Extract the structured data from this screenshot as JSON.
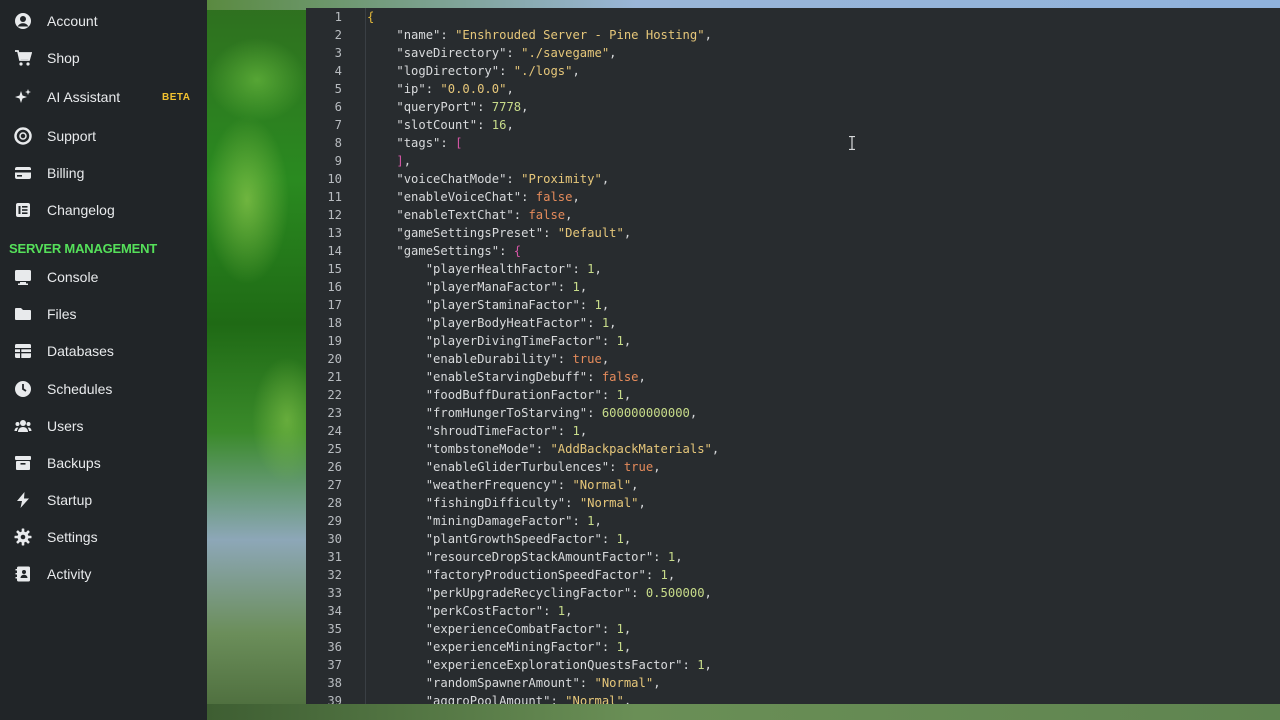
{
  "sidebar": {
    "items": [
      {
        "label": "Account",
        "icon": "account-icon"
      },
      {
        "label": "Shop",
        "icon": "cart-icon"
      },
      {
        "label": "AI Assistant",
        "icon": "sparkle-icon",
        "badge": "BETA"
      },
      {
        "label": "Support",
        "icon": "support-icon"
      },
      {
        "label": "Billing",
        "icon": "billing-icon"
      },
      {
        "label": "Changelog",
        "icon": "changelog-icon"
      }
    ],
    "section_header": "SERVER MANAGEMENT",
    "server_items": [
      {
        "label": "Console",
        "icon": "console-icon"
      },
      {
        "label": "Files",
        "icon": "folder-icon"
      },
      {
        "label": "Databases",
        "icon": "database-icon"
      },
      {
        "label": "Schedules",
        "icon": "clock-icon"
      },
      {
        "label": "Users",
        "icon": "users-icon"
      },
      {
        "label": "Backups",
        "icon": "backup-icon"
      },
      {
        "label": "Startup",
        "icon": "bolt-icon"
      },
      {
        "label": "Settings",
        "icon": "gear-icon"
      },
      {
        "label": "Activity",
        "icon": "activity-icon"
      }
    ]
  },
  "editor": {
    "lines": [
      {
        "n": "1",
        "indent": 0,
        "tokens": [
          [
            "br1",
            "{"
          ]
        ]
      },
      {
        "n": "2",
        "indent": 1,
        "tokens": [
          [
            "k",
            "\"name\""
          ],
          [
            "p",
            ": "
          ],
          [
            "s",
            "\"Enshrouded Server - Pine Hosting\""
          ],
          [
            "p",
            ","
          ]
        ]
      },
      {
        "n": "3",
        "indent": 1,
        "tokens": [
          [
            "k",
            "\"saveDirectory\""
          ],
          [
            "p",
            ": "
          ],
          [
            "s",
            "\"./savegame\""
          ],
          [
            "p",
            ","
          ]
        ]
      },
      {
        "n": "4",
        "indent": 1,
        "tokens": [
          [
            "k",
            "\"logDirectory\""
          ],
          [
            "p",
            ": "
          ],
          [
            "s",
            "\"./logs\""
          ],
          [
            "p",
            ","
          ]
        ]
      },
      {
        "n": "5",
        "indent": 1,
        "tokens": [
          [
            "k",
            "\"ip\""
          ],
          [
            "p",
            ": "
          ],
          [
            "s",
            "\"0.0.0.0\""
          ],
          [
            "p",
            ","
          ]
        ]
      },
      {
        "n": "6",
        "indent": 1,
        "tokens": [
          [
            "k",
            "\"queryPort\""
          ],
          [
            "p",
            ": "
          ],
          [
            "n",
            "7778"
          ],
          [
            "p",
            ","
          ]
        ]
      },
      {
        "n": "7",
        "indent": 1,
        "tokens": [
          [
            "k",
            "\"slotCount\""
          ],
          [
            "p",
            ": "
          ],
          [
            "n",
            "16"
          ],
          [
            "p",
            ","
          ]
        ]
      },
      {
        "n": "8",
        "indent": 1,
        "tokens": [
          [
            "k",
            "\"tags\""
          ],
          [
            "p",
            ": "
          ],
          [
            "br2",
            "["
          ]
        ]
      },
      {
        "n": "9",
        "indent": 1,
        "tokens": [
          [
            "br2",
            "]"
          ],
          [
            "p",
            ","
          ]
        ]
      },
      {
        "n": "10",
        "indent": 1,
        "tokens": [
          [
            "k",
            "\"voiceChatMode\""
          ],
          [
            "p",
            ": "
          ],
          [
            "s",
            "\"Proximity\""
          ],
          [
            "p",
            ","
          ]
        ]
      },
      {
        "n": "11",
        "indent": 1,
        "tokens": [
          [
            "k",
            "\"enableVoiceChat\""
          ],
          [
            "p",
            ": "
          ],
          [
            "b",
            "false"
          ],
          [
            "p",
            ","
          ]
        ]
      },
      {
        "n": "12",
        "indent": 1,
        "tokens": [
          [
            "k",
            "\"enableTextChat\""
          ],
          [
            "p",
            ": "
          ],
          [
            "b",
            "false"
          ],
          [
            "p",
            ","
          ]
        ]
      },
      {
        "n": "13",
        "indent": 1,
        "tokens": [
          [
            "k",
            "\"gameSettingsPreset\""
          ],
          [
            "p",
            ": "
          ],
          [
            "s",
            "\"Default\""
          ],
          [
            "p",
            ","
          ]
        ]
      },
      {
        "n": "14",
        "indent": 1,
        "tokens": [
          [
            "k",
            "\"gameSettings\""
          ],
          [
            "p",
            ": "
          ],
          [
            "br2",
            "{"
          ]
        ]
      },
      {
        "n": "15",
        "indent": 2,
        "tokens": [
          [
            "k",
            "\"playerHealthFactor\""
          ],
          [
            "p",
            ": "
          ],
          [
            "n",
            "1"
          ],
          [
            "p",
            ","
          ]
        ]
      },
      {
        "n": "16",
        "indent": 2,
        "tokens": [
          [
            "k",
            "\"playerManaFactor\""
          ],
          [
            "p",
            ": "
          ],
          [
            "n",
            "1"
          ],
          [
            "p",
            ","
          ]
        ]
      },
      {
        "n": "17",
        "indent": 2,
        "tokens": [
          [
            "k",
            "\"playerStaminaFactor\""
          ],
          [
            "p",
            ": "
          ],
          [
            "n",
            "1"
          ],
          [
            "p",
            ","
          ]
        ]
      },
      {
        "n": "18",
        "indent": 2,
        "tokens": [
          [
            "k",
            "\"playerBodyHeatFactor\""
          ],
          [
            "p",
            ": "
          ],
          [
            "n",
            "1"
          ],
          [
            "p",
            ","
          ]
        ]
      },
      {
        "n": "19",
        "indent": 2,
        "tokens": [
          [
            "k",
            "\"playerDivingTimeFactor\""
          ],
          [
            "p",
            ": "
          ],
          [
            "n",
            "1"
          ],
          [
            "p",
            ","
          ]
        ]
      },
      {
        "n": "20",
        "indent": 2,
        "tokens": [
          [
            "k",
            "\"enableDurability\""
          ],
          [
            "p",
            ": "
          ],
          [
            "b",
            "true"
          ],
          [
            "p",
            ","
          ]
        ]
      },
      {
        "n": "21",
        "indent": 2,
        "tokens": [
          [
            "k",
            "\"enableStarvingDebuff\""
          ],
          [
            "p",
            ": "
          ],
          [
            "b",
            "false"
          ],
          [
            "p",
            ","
          ]
        ]
      },
      {
        "n": "22",
        "indent": 2,
        "tokens": [
          [
            "k",
            "\"foodBuffDurationFactor\""
          ],
          [
            "p",
            ": "
          ],
          [
            "n",
            "1"
          ],
          [
            "p",
            ","
          ]
        ]
      },
      {
        "n": "23",
        "indent": 2,
        "tokens": [
          [
            "k",
            "\"fromHungerToStarving\""
          ],
          [
            "p",
            ": "
          ],
          [
            "n",
            "600000000000"
          ],
          [
            "p",
            ","
          ]
        ]
      },
      {
        "n": "24",
        "indent": 2,
        "tokens": [
          [
            "k",
            "\"shroudTimeFactor\""
          ],
          [
            "p",
            ": "
          ],
          [
            "n",
            "1"
          ],
          [
            "p",
            ","
          ]
        ]
      },
      {
        "n": "25",
        "indent": 2,
        "tokens": [
          [
            "k",
            "\"tombstoneMode\""
          ],
          [
            "p",
            ": "
          ],
          [
            "s",
            "\"AddBackpackMaterials\""
          ],
          [
            "p",
            ","
          ]
        ]
      },
      {
        "n": "26",
        "indent": 2,
        "tokens": [
          [
            "k",
            "\"enableGliderTurbulences\""
          ],
          [
            "p",
            ": "
          ],
          [
            "b",
            "true"
          ],
          [
            "p",
            ","
          ]
        ]
      },
      {
        "n": "27",
        "indent": 2,
        "tokens": [
          [
            "k",
            "\"weatherFrequency\""
          ],
          [
            "p",
            ": "
          ],
          [
            "s",
            "\"Normal\""
          ],
          [
            "p",
            ","
          ]
        ]
      },
      {
        "n": "28",
        "indent": 2,
        "tokens": [
          [
            "k",
            "\"fishingDifficulty\""
          ],
          [
            "p",
            ": "
          ],
          [
            "s",
            "\"Normal\""
          ],
          [
            "p",
            ","
          ]
        ]
      },
      {
        "n": "29",
        "indent": 2,
        "tokens": [
          [
            "k",
            "\"miningDamageFactor\""
          ],
          [
            "p",
            ": "
          ],
          [
            "n",
            "1"
          ],
          [
            "p",
            ","
          ]
        ]
      },
      {
        "n": "30",
        "indent": 2,
        "tokens": [
          [
            "k",
            "\"plantGrowthSpeedFactor\""
          ],
          [
            "p",
            ": "
          ],
          [
            "n",
            "1"
          ],
          [
            "p",
            ","
          ]
        ]
      },
      {
        "n": "31",
        "indent": 2,
        "tokens": [
          [
            "k",
            "\"resourceDropStackAmountFactor\""
          ],
          [
            "p",
            ": "
          ],
          [
            "n",
            "1"
          ],
          [
            "p",
            ","
          ]
        ]
      },
      {
        "n": "32",
        "indent": 2,
        "tokens": [
          [
            "k",
            "\"factoryProductionSpeedFactor\""
          ],
          [
            "p",
            ": "
          ],
          [
            "n",
            "1"
          ],
          [
            "p",
            ","
          ]
        ]
      },
      {
        "n": "33",
        "indent": 2,
        "tokens": [
          [
            "k",
            "\"perkUpgradeRecyclingFactor\""
          ],
          [
            "p",
            ": "
          ],
          [
            "n",
            "0.500000"
          ],
          [
            "p",
            ","
          ]
        ]
      },
      {
        "n": "34",
        "indent": 2,
        "tokens": [
          [
            "k",
            "\"perkCostFactor\""
          ],
          [
            "p",
            ": "
          ],
          [
            "n",
            "1"
          ],
          [
            "p",
            ","
          ]
        ]
      },
      {
        "n": "35",
        "indent": 2,
        "tokens": [
          [
            "k",
            "\"experienceCombatFactor\""
          ],
          [
            "p",
            ": "
          ],
          [
            "n",
            "1"
          ],
          [
            "p",
            ","
          ]
        ]
      },
      {
        "n": "36",
        "indent": 2,
        "tokens": [
          [
            "k",
            "\"experienceMiningFactor\""
          ],
          [
            "p",
            ": "
          ],
          [
            "n",
            "1"
          ],
          [
            "p",
            ","
          ]
        ]
      },
      {
        "n": "37",
        "indent": 2,
        "tokens": [
          [
            "k",
            "\"experienceExplorationQuestsFactor\""
          ],
          [
            "p",
            ": "
          ],
          [
            "n",
            "1"
          ],
          [
            "p",
            ","
          ]
        ]
      },
      {
        "n": "38",
        "indent": 2,
        "tokens": [
          [
            "k",
            "\"randomSpawnerAmount\""
          ],
          [
            "p",
            ": "
          ],
          [
            "s",
            "\"Normal\""
          ],
          [
            "p",
            ","
          ]
        ]
      },
      {
        "n": "39",
        "indent": 2,
        "tokens": [
          [
            "k",
            "\"aggroPoolAmount\""
          ],
          [
            "p",
            ": "
          ],
          [
            "s",
            "\"Normal\""
          ],
          [
            "p",
            ","
          ]
        ]
      }
    ]
  },
  "colors": {
    "sidebar_bg": "#212528",
    "section_header": "#55e05a",
    "beta_badge": "#f2c230",
    "editor_bg": "#282c2f",
    "string": "#e6c77a",
    "number": "#c8dc8a",
    "boolean": "#e58b5b"
  }
}
